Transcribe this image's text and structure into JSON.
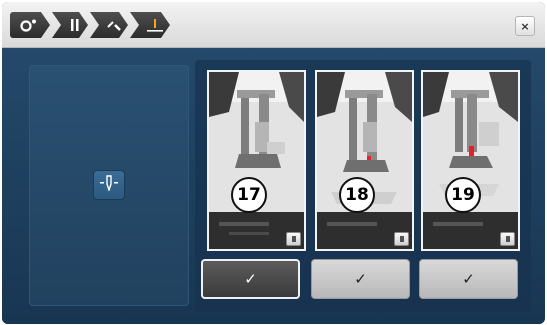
{
  "breadcrumbs": [
    {
      "icon": "presser-foot-settings-icon"
    },
    {
      "icon": "needle-pause-icon"
    },
    {
      "icon": "needle-threader-icon"
    },
    {
      "icon": "needle-position-icon"
    }
  ],
  "close": {
    "label": "×",
    "icon": "close-icon"
  },
  "left_panel": {
    "button_icon": "needle-icon"
  },
  "steps": [
    {
      "number": "17",
      "pause_label": "II",
      "check_label": "✓",
      "selected": true
    },
    {
      "number": "18",
      "pause_label": "II",
      "check_label": "✓",
      "selected": false
    },
    {
      "number": "19",
      "pause_label": "II",
      "check_label": "✓",
      "selected": false
    }
  ],
  "colors": {
    "background": "#1c3e5c",
    "active_check": "#4a4a4a",
    "inactive_check": "#c8c8c8",
    "accent_red": "#e8202a"
  }
}
